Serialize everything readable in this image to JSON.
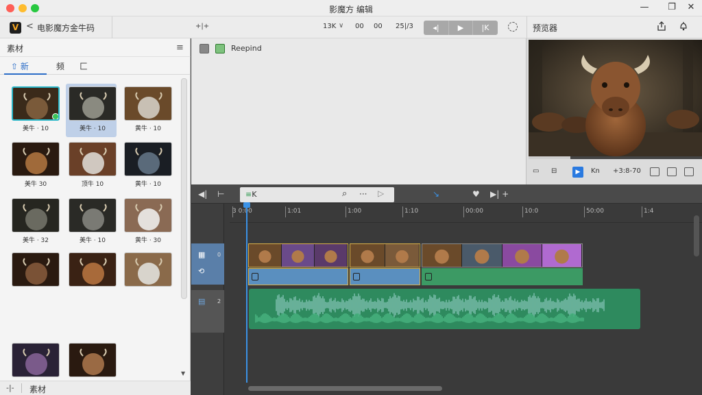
{
  "window": {
    "title": "影魔方 编辑",
    "minimize": "—",
    "restore": "❐",
    "close": "✕"
  },
  "toolbar": {
    "logo": "V",
    "back": "<",
    "project_title": "电影魔方金牛码",
    "fx": "+|+",
    "resolution": "13K",
    "res_caret": "∨",
    "tc1": "00",
    "tc2": "00",
    "fps": "25|/3",
    "prev": "◂|",
    "play": "▶",
    "next": "|K",
    "preview_label": "预览器"
  },
  "media": {
    "title": "素材",
    "menu": "≡",
    "tabs": [
      {
        "label": "新"
      },
      {
        "label": "频"
      },
      {
        "label": "匚"
      }
    ],
    "tab_new_icon": "⇧",
    "items": [
      {
        "label": "美牛 · 10"
      },
      {
        "label": "美牛 · 10"
      },
      {
        "label": "黄牛 · 10"
      },
      {
        "label": "美牛 30"
      },
      {
        "label": "顶牛 10"
      },
      {
        "label": "黄牛 · 10"
      },
      {
        "label": "美牛 · 32"
      },
      {
        "label": "美牛 · 10"
      },
      {
        "label": "黄牛 · 30"
      },
      {
        "label": ""
      },
      {
        "label": ""
      },
      {
        "label": ""
      },
      {
        "label": ""
      },
      {
        "label": ""
      }
    ],
    "footer_icon": "-|-",
    "footer_label": "素材"
  },
  "viewer": {
    "label": "Reepind"
  },
  "preview": {
    "controls": [
      "▭",
      "⊟",
      "Kn",
      "+3:8-70"
    ],
    "cursor_glyph": "▶",
    "progress": 0.24
  },
  "timeline": {
    "tool_left": "◀|",
    "tool_undo": "⊢",
    "search_prefix": "≡",
    "search_text": "K",
    "search_icon": "⌕",
    "more": "···",
    "play": "▷",
    "marker": "↘",
    "heart": "♥",
    "next": "▶| +",
    "ruler": [
      {
        "label": "3 0:00"
      },
      {
        "label": "1:01"
      },
      {
        "label": "1:00"
      },
      {
        "label": "1:10"
      },
      {
        "label": "00:00"
      },
      {
        "label": "10:0"
      },
      {
        "label": "50:00"
      },
      {
        "label": "1:4"
      }
    ],
    "tracks": {
      "video_icon": "▦",
      "video_sub_icon": "⟲",
      "video_num": "0",
      "audio_icon": "▤",
      "audio_num": "2"
    }
  },
  "colors": {
    "accent": "#2a7ae0",
    "audio": "#2e8a5e",
    "video_bar": "#5a8fbf",
    "video_bar_green": "#3c9a64",
    "selection": "#2ab7c9"
  }
}
